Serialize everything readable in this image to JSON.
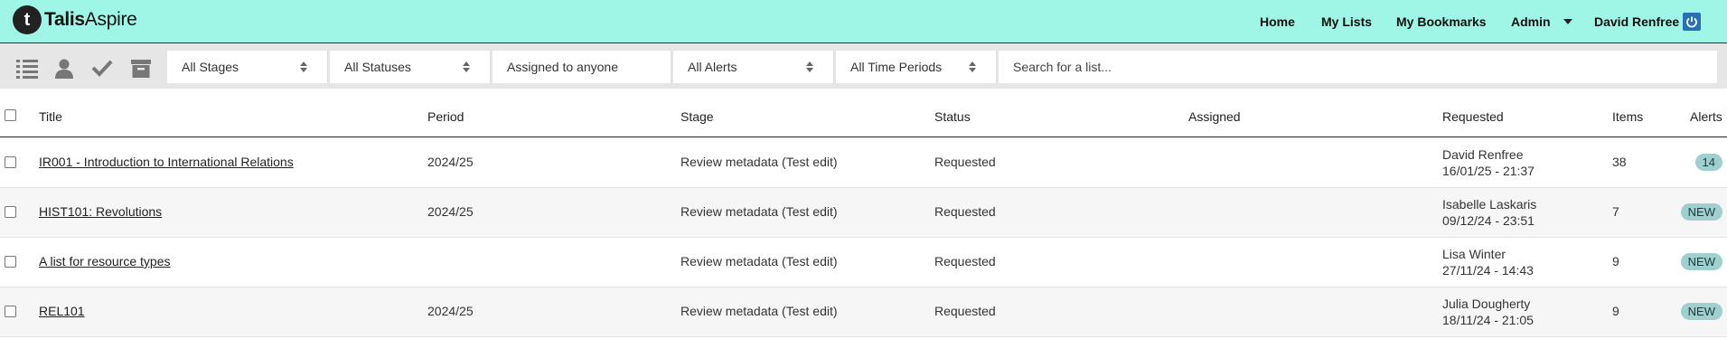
{
  "brand": {
    "bold": "Talis",
    "light": "Aspire",
    "mark": "t"
  },
  "nav": {
    "home": "Home",
    "my_lists": "My Lists",
    "my_bookmarks": "My Bookmarks",
    "admin": "Admin",
    "user": "David Renfree"
  },
  "filters": {
    "stages": "All Stages",
    "statuses": "All Statuses",
    "assigned": "Assigned to anyone",
    "alerts": "All Alerts",
    "periods": "All Time Periods",
    "search_placeholder": "Search for a list..."
  },
  "columns": {
    "title": "Title",
    "period": "Period",
    "stage": "Stage",
    "status": "Status",
    "assigned": "Assigned",
    "requested": "Requested",
    "items": "Items",
    "alerts": "Alerts"
  },
  "rows": [
    {
      "title": "IR001 - Introduction to International Relations",
      "period": "2024/25",
      "stage": "Review metadata (Test edit)",
      "status": "Requested",
      "assigned": "",
      "requested_by": "David Renfree",
      "requested_at": "16/01/25 - 21:37",
      "items": "38",
      "alert": "14"
    },
    {
      "title": "HIST101: Revolutions",
      "period": "2024/25",
      "stage": "Review metadata (Test edit)",
      "status": "Requested",
      "assigned": "",
      "requested_by": "Isabelle Laskaris",
      "requested_at": "09/12/24 - 23:51",
      "items": "7",
      "alert": "NEW"
    },
    {
      "title": "A list for resource types",
      "period": "",
      "stage": "Review metadata (Test edit)",
      "status": "Requested",
      "assigned": "",
      "requested_by": "Lisa Winter",
      "requested_at": "27/11/24 - 14:43",
      "items": "9",
      "alert": "NEW"
    },
    {
      "title": "REL101",
      "period": "2024/25",
      "stage": "Review metadata (Test edit)",
      "status": "Requested",
      "assigned": "",
      "requested_by": "Julia Dougherty",
      "requested_at": "18/11/24 - 21:05",
      "items": "9",
      "alert": "NEW"
    }
  ]
}
